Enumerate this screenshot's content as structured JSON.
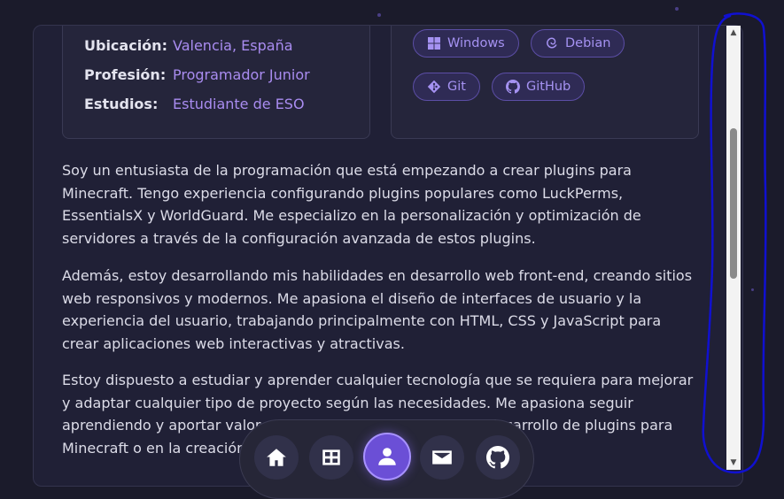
{
  "profile": {
    "location_label": "Ubicación:",
    "location_value": "Valencia, España",
    "profession_label": "Profesión:",
    "profession_value": "Programador Junior",
    "studies_label": "Estudios:",
    "studies_value": "Estudiante de ESO"
  },
  "tech": {
    "chips": [
      "Windows",
      "Debian",
      "Git",
      "GitHub"
    ]
  },
  "about": {
    "p1": "Soy un entusiasta de la programación que está empezando a crear plugins para Minecraft. Tengo experiencia configurando plugins populares como LuckPerms, EssentialsX y WorldGuard. Me especializo en la personalización y optimización de servidores a través de la configuración avanzada de estos plugins.",
    "p2": "Además, estoy desarrollando mis habilidades en desarrollo web front-end, creando sitios web responsivos y modernos. Me apasiona el diseño de interfaces de usuario y la experiencia del usuario, trabajando principalmente con HTML, CSS y JavaScript para crear aplicaciones web interactivas y atractivas.",
    "p3": "Estoy dispuesto a estudiar y aprender cualquier tecnología que se requiera para mejorar y adaptar cualquier tipo de proyecto según las necesidades. Me apasiona seguir aprendiendo y aportar valor en cada proyecto, ya sea en el desarrollo de plugins para Minecraft o en la creación de aplicaciones web."
  },
  "nav": {
    "items": [
      "home",
      "projects",
      "about",
      "contact",
      "github"
    ],
    "active": "about",
    "icons": [
      "home-icon",
      "grid-icon",
      "user-icon",
      "envelope-icon",
      "github-icon"
    ]
  },
  "colors": {
    "background": "#1b1b2b",
    "accent": "#a98cf0",
    "active_nav": "#6b4fd6",
    "annotation": "#1010d0"
  }
}
